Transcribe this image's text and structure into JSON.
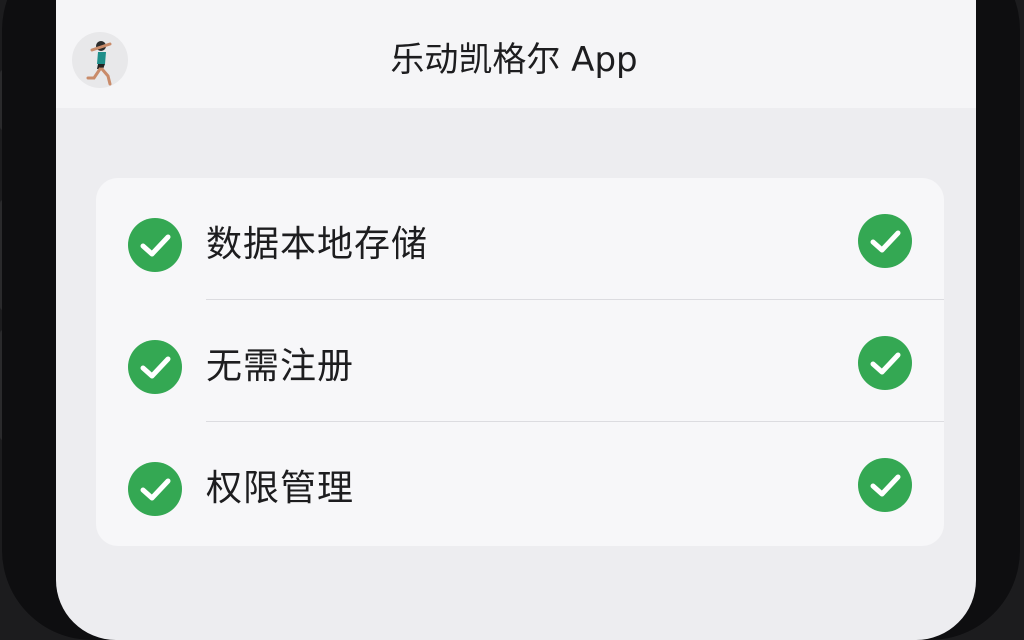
{
  "app": {
    "title": "乐动凯格尔 App",
    "avatar_icon": "runner-avatar-icon"
  },
  "features": {
    "items": [
      {
        "label": "数据本地存储",
        "left_icon": "check-circle-icon",
        "right_icon": "check-circle-icon",
        "checked": true
      },
      {
        "label": "无需注册",
        "left_icon": "check-circle-icon",
        "right_icon": "check-circle-icon",
        "checked": true
      },
      {
        "label": "权限管理",
        "left_icon": "check-circle-icon",
        "right_icon": "check-circle-icon",
        "checked": true
      }
    ]
  },
  "colors": {
    "accent_green": "#34a853",
    "screen_bg": "#ededf0",
    "card_bg": "#f7f7f9",
    "text": "#1d1d1f",
    "frame": "#0e0e10"
  }
}
